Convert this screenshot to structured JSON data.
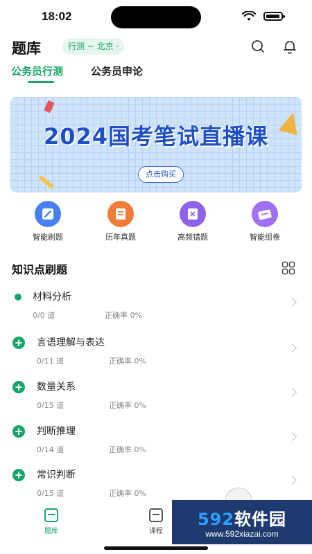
{
  "status_bar": {
    "time": "18:02"
  },
  "header": {
    "title": "题库",
    "exam_selector": "行测 ~ 北京 ·"
  },
  "tabs": [
    {
      "label": "公务员行测",
      "active": true
    },
    {
      "label": "公务员申论",
      "active": false
    }
  ],
  "banner": {
    "title": "2024国考笔试直播课",
    "button_label": "点击购买"
  },
  "quick_actions": [
    {
      "label": "智能刷题",
      "icon": "pencil-icon",
      "color": "#4a7ff0"
    },
    {
      "label": "历年真题",
      "icon": "scroll-icon",
      "color": "#f27a3a"
    },
    {
      "label": "高频错题",
      "icon": "error-book-icon",
      "color": "#8e63e9"
    },
    {
      "label": "智能组卷",
      "icon": "paper-stack-icon",
      "color": "#a070f2"
    }
  ],
  "section": {
    "title": "知识点刷题"
  },
  "knowledge_points": [
    {
      "name": "材料分析",
      "progress": "0/0 道",
      "accuracy": "正确率 0%",
      "marker": "dot"
    },
    {
      "name": "言语理解与表达",
      "progress": "0/11 道",
      "accuracy": "正确率 0%",
      "marker": "plus"
    },
    {
      "name": "数量关系",
      "progress": "0/15 道",
      "accuracy": "正确率 0%",
      "marker": "plus"
    },
    {
      "name": "判断推理",
      "progress": "0/14 道",
      "accuracy": "正确率 0%",
      "marker": "plus"
    },
    {
      "name": "常识判断",
      "progress": "0/15 道",
      "accuracy": "正确率 0%",
      "marker": "plus"
    }
  ],
  "bottom_nav": [
    {
      "label": "题库",
      "active": true
    },
    {
      "label": "课程",
      "active": false
    }
  ],
  "watermark": {
    "brand_num": "592",
    "brand_text": "软件园",
    "url": "www.592xiazai.com"
  },
  "colors": {
    "accent": "#1aa46a",
    "banner_text": "#1f4ec8"
  }
}
